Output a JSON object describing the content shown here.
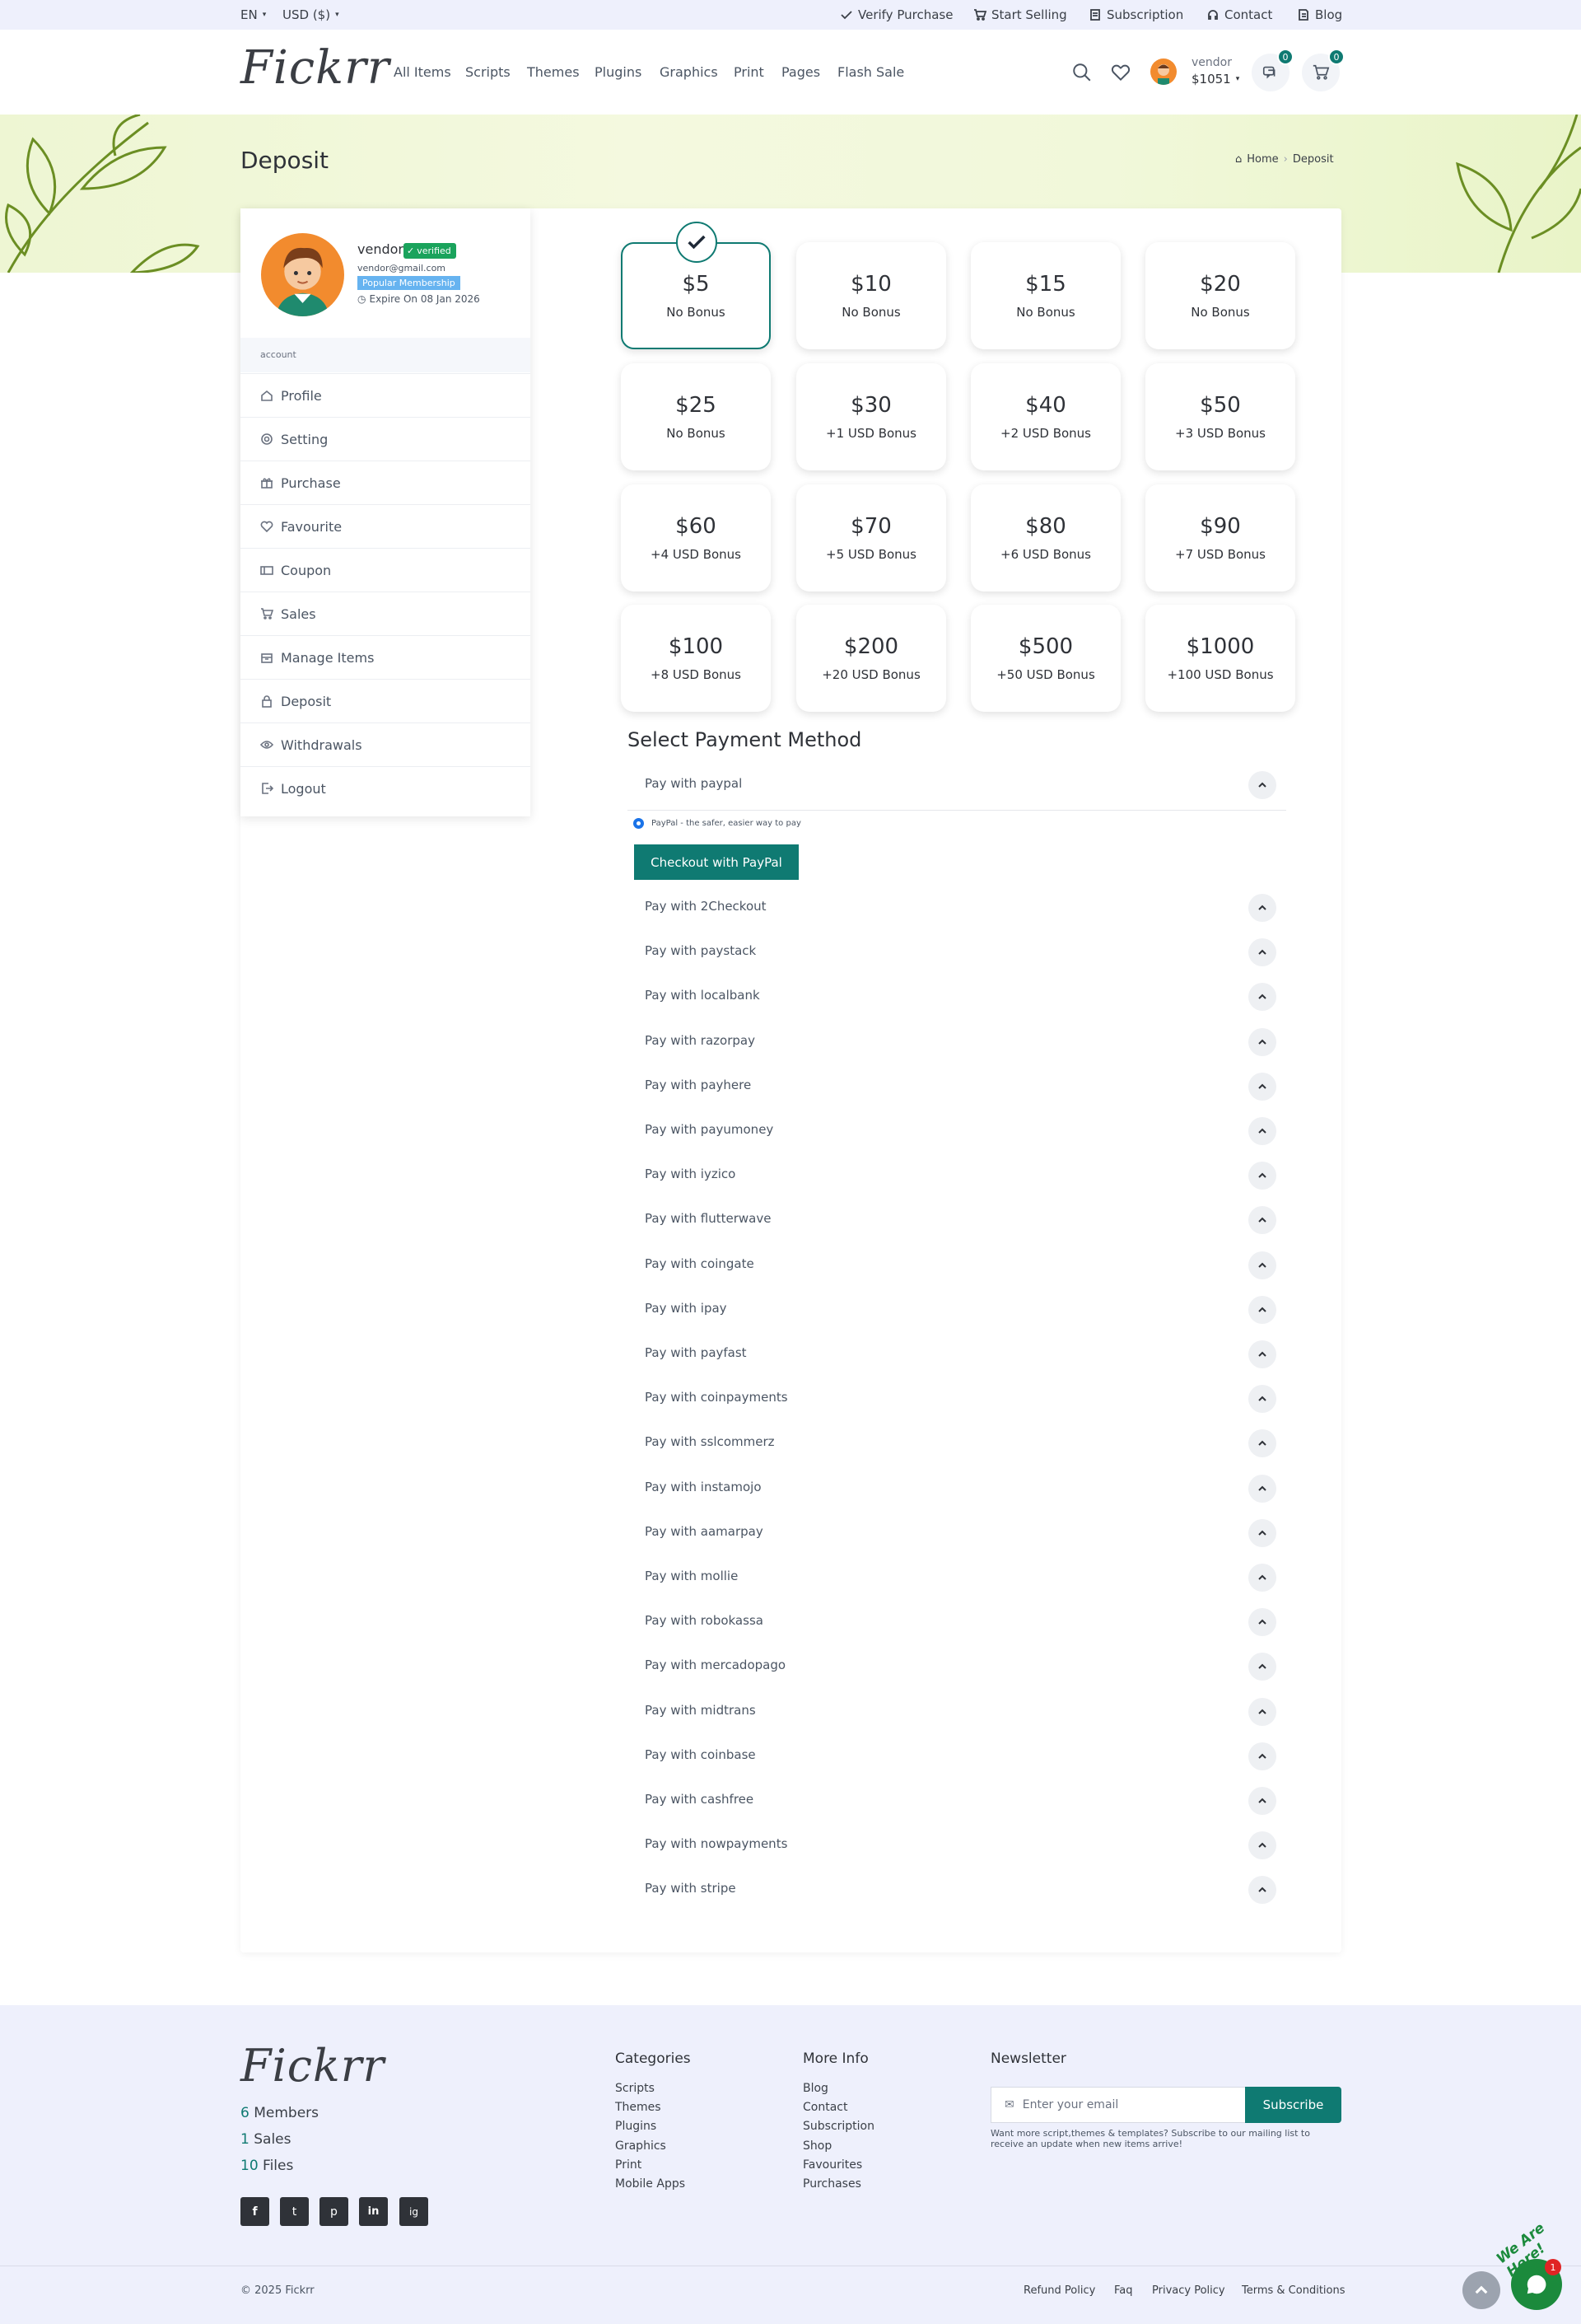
{
  "topbar": {
    "language": "EN",
    "currency": "USD ($)",
    "links": [
      "Verify Purchase",
      "Start Selling",
      "Subscription",
      "Contact",
      "Blog"
    ]
  },
  "header": {
    "logo": "Fickrr",
    "nav": [
      "All Items",
      "Scripts",
      "Themes",
      "Plugins",
      "Graphics",
      "Print",
      "Pages",
      "Flash Sale"
    ],
    "user_name": "vendor",
    "user_balance": "$1051",
    "message_count": "0",
    "cart_count": "0"
  },
  "page": {
    "title": "Deposit",
    "breadcrumb": [
      "Home",
      "Deposit"
    ]
  },
  "profile": {
    "name": "vendor",
    "verified_label": "verified",
    "email": "vendor@gmail.com",
    "membership": "Popular Membership",
    "expire": "Expire On 08 Jan 2026",
    "section_label": "account",
    "menu": [
      "Profile",
      "Setting",
      "Purchase",
      "Favourite",
      "Coupon",
      "Sales",
      "Manage Items",
      "Deposit",
      "Withdrawals",
      "Logout"
    ]
  },
  "amounts": [
    {
      "value": "$5",
      "bonus": "No Bonus"
    },
    {
      "value": "$10",
      "bonus": "No Bonus"
    },
    {
      "value": "$15",
      "bonus": "No Bonus"
    },
    {
      "value": "$20",
      "bonus": "No Bonus"
    },
    {
      "value": "$25",
      "bonus": "No Bonus"
    },
    {
      "value": "$30",
      "bonus": "+1 USD Bonus"
    },
    {
      "value": "$40",
      "bonus": "+2 USD Bonus"
    },
    {
      "value": "$50",
      "bonus": "+3 USD Bonus"
    },
    {
      "value": "$60",
      "bonus": "+4 USD Bonus"
    },
    {
      "value": "$70",
      "bonus": "+5 USD Bonus"
    },
    {
      "value": "$80",
      "bonus": "+6 USD Bonus"
    },
    {
      "value": "$90",
      "bonus": "+7 USD Bonus"
    },
    {
      "value": "$100",
      "bonus": "+8 USD Bonus"
    },
    {
      "value": "$200",
      "bonus": "+20 USD Bonus"
    },
    {
      "value": "$500",
      "bonus": "+50 USD Bonus"
    },
    {
      "value": "$1000",
      "bonus": "+100 USD Bonus"
    }
  ],
  "selected_amount": "$5",
  "payment": {
    "title": "Select Payment Method",
    "paypal_label": "Pay with paypal",
    "paypal_radio": "PayPal - the safer, easier way to pay",
    "paypal_button": "Checkout with PayPal",
    "methods": [
      "Pay with 2Checkout",
      "Pay with paystack",
      "Pay with localbank",
      "Pay with razorpay",
      "Pay with payhere",
      "Pay with payumoney",
      "Pay with iyzico",
      "Pay with flutterwave",
      "Pay with coingate",
      "Pay with ipay",
      "Pay with payfast",
      "Pay with coinpayments",
      "Pay with sslcommerz",
      "Pay with instamojo",
      "Pay with aamarpay",
      "Pay with mollie",
      "Pay with robokassa",
      "Pay with mercadopago",
      "Pay with midtrans",
      "Pay with coinbase",
      "Pay with cashfree",
      "Pay with nowpayments",
      "Pay with stripe"
    ]
  },
  "footer": {
    "logo": "Fickrr",
    "stats": [
      {
        "num": "6",
        "label": "Members"
      },
      {
        "num": "1",
        "label": "Sales"
      },
      {
        "num": "10",
        "label": "Files"
      }
    ],
    "social": [
      "f",
      "t",
      "p",
      "in",
      "ig"
    ],
    "categories_title": "Categories",
    "categories": [
      "Scripts",
      "Themes",
      "Plugins",
      "Graphics",
      "Print",
      "Mobile Apps"
    ],
    "more_title": "More Info",
    "more": [
      "Blog",
      "Contact",
      "Subscription",
      "Shop",
      "Favourites",
      "Purchases"
    ],
    "newsletter_title": "Newsletter",
    "newsletter_placeholder": "Enter your email",
    "subscribe_label": "Subscribe",
    "newsletter_note": "Want more script,themes & templates? Subscribe to our mailing list to receive an update when new items arrive!",
    "copyright": "© 2025 Fickrr",
    "legal": [
      "Refund Policy",
      "Faq",
      "Privacy Policy",
      "Terms & Conditions"
    ],
    "chat_label": "We Are Here!",
    "chat_count": "1"
  },
  "colors": {
    "accent": "#0f7a72",
    "verified": "#1aa35c",
    "membership": "#66b3f0",
    "topbar": "#eef0fc"
  }
}
